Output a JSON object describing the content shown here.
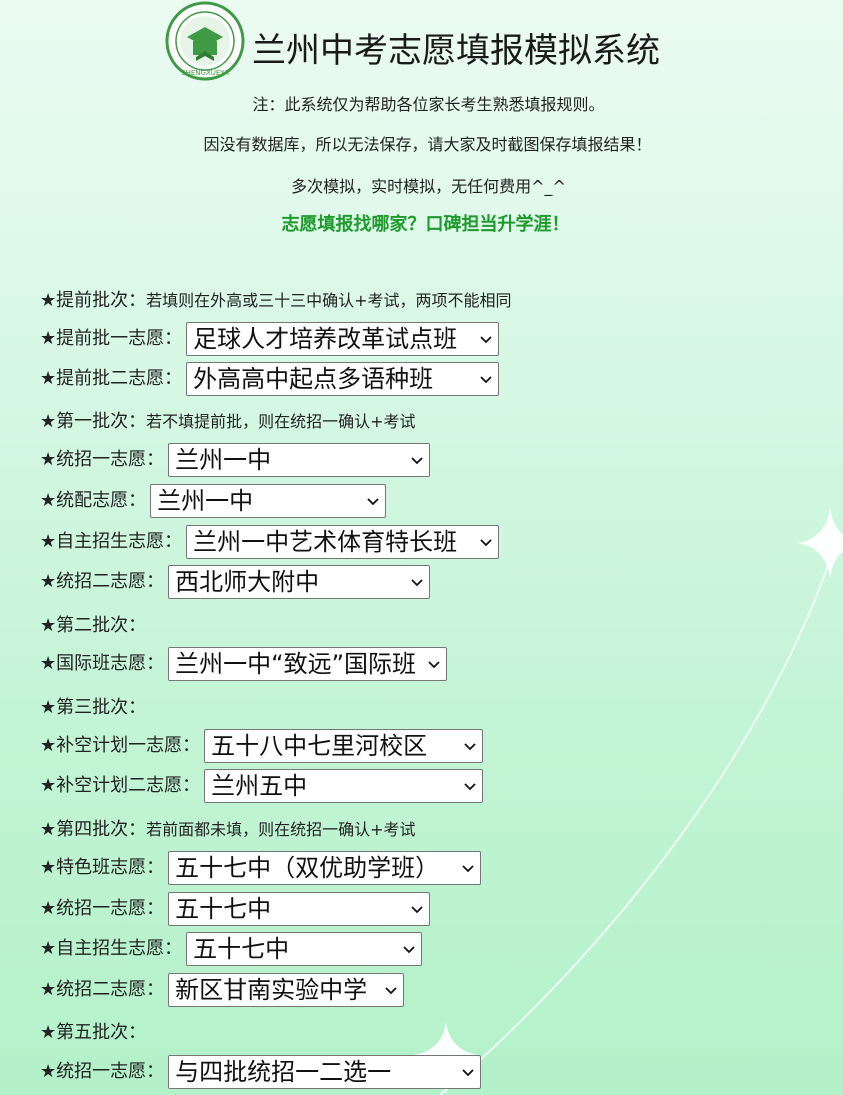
{
  "header": {
    "title": "兰州中考志愿填报模拟系统",
    "logo_text": "SHENGXUEYA",
    "note_1": "注：此系统仅为帮助各位家长考生熟悉填报规则。",
    "note_2": "因没有数据库，所以无法保存，请大家及时截图保存填报结果！",
    "note_3": "多次模拟，实时模拟，无任何费用^_^",
    "slogan": "志愿填报找哪家？口碑担当升学涯！"
  },
  "colors": {
    "slogan": "#1f9a2c",
    "logo_green": "#3f9a45"
  },
  "batches": {
    "early": {
      "label": "★提前批次：",
      "desc": "若填则在外高或三十三中确认+考试，两项不能相同"
    },
    "first": {
      "label": "★第一批次：",
      "desc": "若不填提前批，则在统招一确认+考试"
    },
    "second": {
      "label": "★第二批次："
    },
    "third": {
      "label": "★第三批次："
    },
    "fourth": {
      "label": "★第四批次：",
      "desc": "若前面都未填，则在统招一确认+考试"
    },
    "fifth": {
      "label": "★第五批次："
    }
  },
  "fields": {
    "early_1": {
      "label": "★提前批一志愿：",
      "value": "足球人才培养改革试点班"
    },
    "early_2": {
      "label": "★提前批二志愿：",
      "value": "外高高中起点多语种班"
    },
    "b1_tongzhao_1": {
      "label": "★统招一志愿：",
      "value": "兰州一中"
    },
    "b1_tongpei": {
      "label": "★统配志愿：",
      "value": "兰州一中"
    },
    "b1_zizhu": {
      "label": "★自主招生志愿：",
      "value": "兰州一中艺术体育特长班"
    },
    "b1_tongzhao_2": {
      "label": "★统招二志愿：",
      "value": "西北师大附中"
    },
    "b2_intl": {
      "label": "★国际班志愿：",
      "value": "兰州一中“致远”国际班"
    },
    "b3_bukong_1": {
      "label": "★补空计划一志愿：",
      "value": "五十八中七里河校区"
    },
    "b3_bukong_2": {
      "label": "★补空计划二志愿：",
      "value": "兰州五中"
    },
    "b4_tese": {
      "label": "★特色班志愿：",
      "value": "五十七中（双优助学班）"
    },
    "b4_tongzhao_1": {
      "label": "★统招一志愿：",
      "value": "五十七中"
    },
    "b4_zizhu": {
      "label": "★自主招生志愿：",
      "value": "五十七中"
    },
    "b4_tongzhao_2": {
      "label": "★统招二志愿：",
      "value": "新区甘南实验中学"
    },
    "b5_tongzhao_1": {
      "label": "★统招一志愿：",
      "value": "与四批统招一二选一"
    }
  }
}
